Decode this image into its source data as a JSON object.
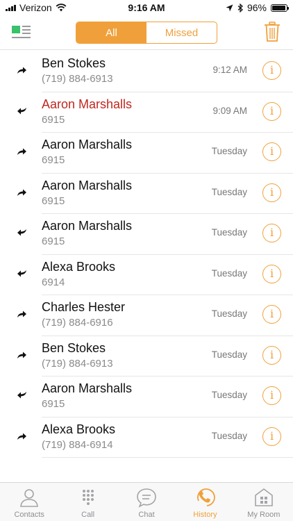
{
  "status_bar": {
    "carrier": "Verizon",
    "time": "9:16 AM",
    "battery": "96%",
    "battery_level": 0.96
  },
  "header": {
    "segments": [
      {
        "label": "All",
        "active": true
      },
      {
        "label": "Missed",
        "active": false
      }
    ]
  },
  "calls": [
    {
      "name": "Ben Stokes",
      "number": "(719) 884-6913",
      "time": "9:12 AM",
      "direction": "outgoing",
      "missed": false
    },
    {
      "name": "Aaron Marshalls",
      "number": "6915",
      "time": "9:09 AM",
      "direction": "incoming",
      "missed": true
    },
    {
      "name": "Aaron Marshalls",
      "number": "6915",
      "time": "Tuesday",
      "direction": "outgoing",
      "missed": false
    },
    {
      "name": "Aaron Marshalls",
      "number": "6915",
      "time": "Tuesday",
      "direction": "outgoing",
      "missed": false
    },
    {
      "name": "Aaron Marshalls",
      "number": "6915",
      "time": "Tuesday",
      "direction": "incoming",
      "missed": false
    },
    {
      "name": "Alexa Brooks",
      "number": "6914",
      "time": "Tuesday",
      "direction": "incoming",
      "missed": false
    },
    {
      "name": "Charles Hester",
      "number": "(719) 884-6916",
      "time": "Tuesday",
      "direction": "outgoing",
      "missed": false
    },
    {
      "name": "Ben Stokes",
      "number": "(719) 884-6913",
      "time": "Tuesday",
      "direction": "outgoing",
      "missed": false
    },
    {
      "name": "Aaron Marshalls",
      "number": "6915",
      "time": "Tuesday",
      "direction": "incoming",
      "missed": false
    },
    {
      "name": "Alexa Brooks",
      "number": "(719) 884-6914",
      "time": "Tuesday",
      "direction": "outgoing",
      "missed": false
    }
  ],
  "tabbar": {
    "tabs": [
      {
        "label": "Contacts",
        "icon": "person-icon",
        "active": false
      },
      {
        "label": "Call",
        "icon": "keypad-icon",
        "active": false
      },
      {
        "label": "Chat",
        "icon": "chat-bubble-icon",
        "active": false
      },
      {
        "label": "History",
        "icon": "clock-phone-icon",
        "active": true
      },
      {
        "label": "My Room",
        "icon": "room-icon",
        "active": false
      }
    ]
  },
  "colors": {
    "accent": "#f0a03a",
    "missed": "#c0271f",
    "menu_green": "#39c16c"
  }
}
